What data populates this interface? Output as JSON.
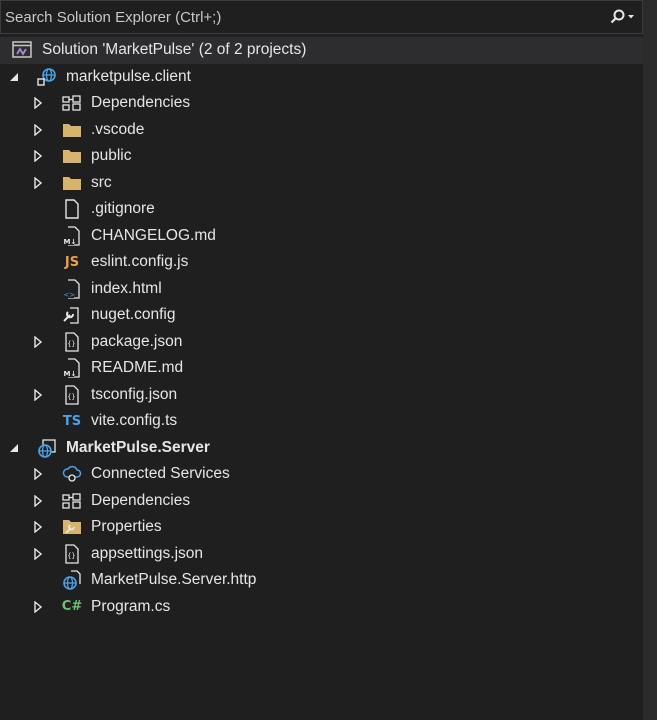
{
  "search": {
    "placeholder": "Search Solution Explorer (Ctrl+;)"
  },
  "tree": {
    "solution": {
      "label": "Solution 'MarketPulse' (2 of 2 projects)",
      "icon": "solution-icon"
    },
    "client": {
      "label": "marketpulse.client",
      "icon": "web-project-icon",
      "items": [
        {
          "label": "Dependencies",
          "icon": "dependencies-icon",
          "expandable": true
        },
        {
          "label": ".vscode",
          "icon": "folder-icon",
          "expandable": true
        },
        {
          "label": "public",
          "icon": "folder-icon",
          "expandable": true
        },
        {
          "label": "src",
          "icon": "folder-icon",
          "expandable": true
        },
        {
          "label": ".gitignore",
          "icon": "file-icon",
          "expandable": false
        },
        {
          "label": "CHANGELOG.md",
          "icon": "markdown-icon",
          "expandable": false
        },
        {
          "label": "eslint.config.js",
          "icon": "js-icon",
          "expandable": false
        },
        {
          "label": "index.html",
          "icon": "html-icon",
          "expandable": false
        },
        {
          "label": "nuget.config",
          "icon": "config-icon",
          "expandable": false
        },
        {
          "label": "package.json",
          "icon": "json-icon",
          "expandable": true
        },
        {
          "label": "README.md",
          "icon": "markdown-icon",
          "expandable": false
        },
        {
          "label": "tsconfig.json",
          "icon": "json-icon",
          "expandable": true
        },
        {
          "label": "vite.config.ts",
          "icon": "ts-icon",
          "expandable": false
        }
      ]
    },
    "server": {
      "label": "MarketPulse.Server",
      "icon": "web-project-icon",
      "items": [
        {
          "label": "Connected Services",
          "icon": "connected-services-icon",
          "expandable": true
        },
        {
          "label": "Dependencies",
          "icon": "dependencies-icon",
          "expandable": true
        },
        {
          "label": "Properties",
          "icon": "properties-icon",
          "expandable": true
        },
        {
          "label": "appsettings.json",
          "icon": "json-icon",
          "expandable": true
        },
        {
          "label": "MarketPulse.Server.http",
          "icon": "http-file-icon",
          "expandable": false
        },
        {
          "label": "Program.cs",
          "icon": "csharp-icon",
          "expandable": true
        }
      ]
    }
  },
  "icon_glyphs": {
    "js": "JS",
    "ts": "TS",
    "csharp": "C#"
  },
  "colors": {
    "background": "#1f1f1f",
    "text": "#e6e6e6",
    "folder": "#d8b36a",
    "js": "#e8a24c",
    "ts": "#4aa3e8",
    "csharp": "#6dc26d",
    "globe": "#4aa3e8",
    "solution": "#a58ad8"
  }
}
